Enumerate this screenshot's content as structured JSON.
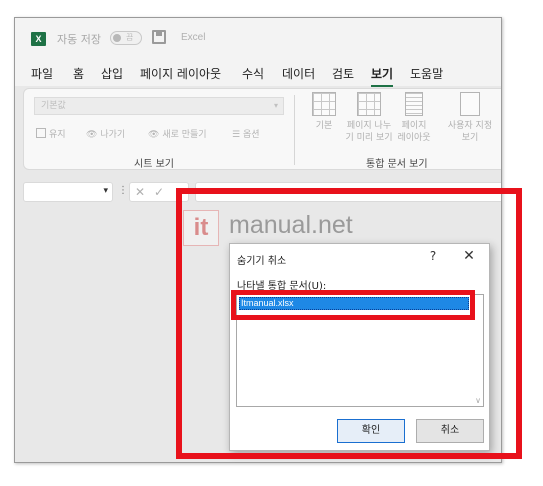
{
  "titlebar": {
    "app_icon": "X",
    "autosave_label": "자동 저장",
    "autosave_state": "끔",
    "app_name": "Excel"
  },
  "menu": {
    "tabs": [
      "파일",
      "홈",
      "삽입",
      "페이지 레이아웃",
      "수식",
      "데이터",
      "검토",
      "보기",
      "도움말"
    ],
    "active_tab": "보기"
  },
  "ribbon": {
    "sheet_view": {
      "select_value": "기본값",
      "buttons": [
        "유지",
        "나가기",
        "새로 만들기",
        "옵션"
      ],
      "group_label": "시트 보기"
    },
    "workbook_view": {
      "buttons": [
        "기본",
        "페이지 나누\n기 미리 보기",
        "페이지\n레이아웃",
        "사용자 지정\n보기"
      ],
      "group_label": "통합 문서 보기"
    }
  },
  "formula_bar": {
    "fx_dots": "⋮",
    "cancel_icon": "✕",
    "enter_icon": "✓"
  },
  "watermark": {
    "badge": "it",
    "text": "manual.net"
  },
  "dialog": {
    "title": "숨기기 취소",
    "help": "?",
    "close": "✕",
    "list_label": "나타낼 통합 문서(U):",
    "items": [
      "Itmanual.xlsx"
    ],
    "ok_label": "확인",
    "cancel_label": "취소"
  },
  "colors": {
    "excel_green": "#1e7145",
    "highlight_red": "#e8111b",
    "selection_blue": "#1e88e5"
  }
}
